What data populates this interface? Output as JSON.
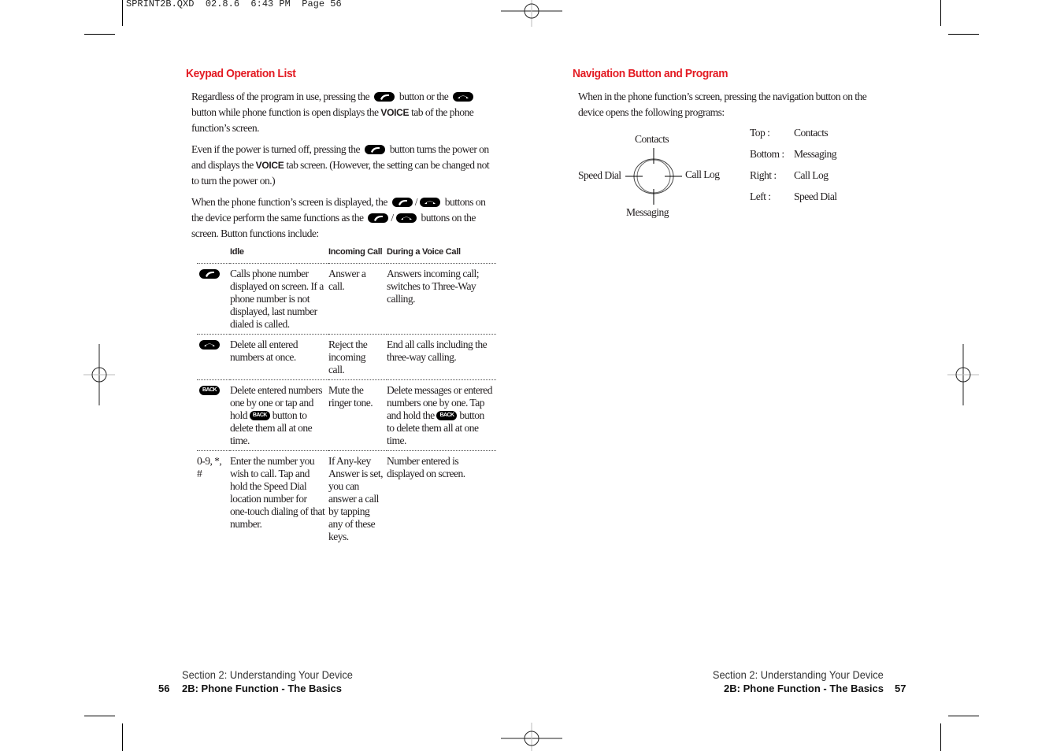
{
  "slug": "SPRINT2B.QXD  02.8.6  6:43 PM  Page 56",
  "left_page": {
    "heading": "Keypad Operation List",
    "para1": {
      "t1": "Regardless of the program in use, pressing the",
      "t2": "button or the",
      "t3": "button while phone function is open displays the",
      "bold": "VOICE",
      "t4": "tab of the phone function’s screen."
    },
    "para2": {
      "t1": "Even if the power is turned off, pressing the",
      "t2": "button turns the power on and displays the",
      "bold": "VOICE",
      "t3": "tab screen. (However, the setting can be changed not to turn the power on.)"
    },
    "para3": {
      "t1": "When the phone function’s screen is displayed, the",
      "slash": "/",
      "t2": "buttons on the device perform the same functions as the",
      "t3": "buttons on the screen. Button functions include:"
    },
    "table": {
      "headers": [
        "",
        "Idle",
        "Incoming Call",
        "During a Voice Call"
      ],
      "rows": [
        {
          "key_icon": "talk-icon",
          "key_text": "",
          "idle": "Calls phone number displayed on screen. If a phone number is not displayed, last number dialed is called.",
          "incoming": "Answer a call.",
          "during": "Answers incoming call; switches to Three-Way calling."
        },
        {
          "key_icon": "end-icon",
          "key_text": "",
          "idle": "Delete all entered numbers at once.",
          "incoming": "Reject the incoming call.",
          "during": "End all calls including the three-way calling."
        },
        {
          "key_icon": "back-icon",
          "key_text": "",
          "idle_a": "Delete entered numbers one by one or tap and hold",
          "idle_b": "button to delete them all at one time.",
          "incoming": "Mute the ringer tone.",
          "during_a": "Delete messages or entered numbers one by one. Tap and hold the",
          "during_b": "button to delete them all at one time."
        },
        {
          "key_icon": "",
          "key_text": "0-9, *, #",
          "idle": "Enter the number you wish to call. Tap and hold the Speed Dial location number for one-touch dialing of that number.",
          "incoming": "If Any-key Answer is set, you can answer a call by tapping any of these keys.",
          "during": "Number entered is displayed on screen."
        }
      ]
    },
    "back_label": "BACK",
    "footer": {
      "section": "Section 2: Understanding Your Device",
      "page": "56",
      "chapter": "2B: Phone Function - The Basics"
    }
  },
  "right_page": {
    "heading": "Navigation Button and Program",
    "intro": "When in the phone function’s screen, pressing the navigation button on the device opens the following programs:",
    "diagram": {
      "top": "Contacts",
      "bottom": "Messaging",
      "left": "Speed Dial",
      "right": "Call Log"
    },
    "mapping": [
      {
        "dir": "Top :",
        "program": "Contacts"
      },
      {
        "dir": "Bottom :",
        "program": "Messaging"
      },
      {
        "dir": "Right :",
        "program": "Call Log"
      },
      {
        "dir": "Left :",
        "program": "Speed Dial"
      }
    ],
    "footer": {
      "section": "Section 2: Understanding Your Device",
      "page": "57",
      "chapter": "2B: Phone Function - The Basics"
    }
  },
  "colors": {
    "heading": "#e31b23",
    "text": "#231f20"
  }
}
